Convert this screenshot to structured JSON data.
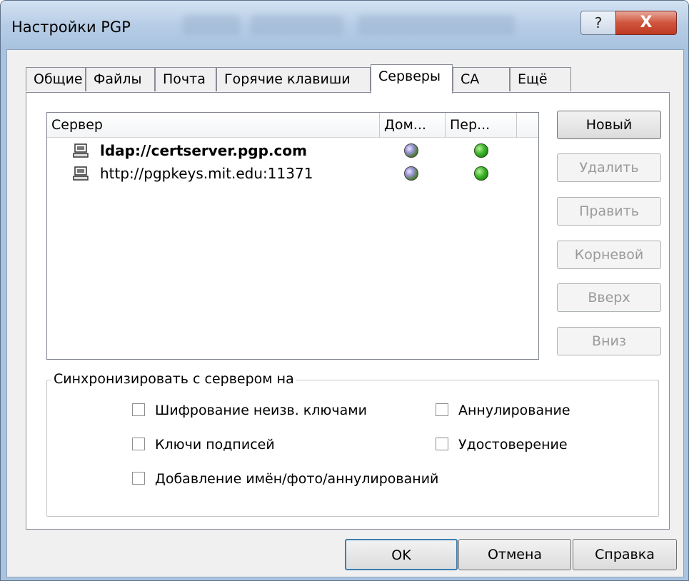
{
  "window": {
    "title": "Настройки PGP",
    "help_label": "?",
    "close_label": "X"
  },
  "tabs": [
    {
      "label": "Общие"
    },
    {
      "label": "Файлы"
    },
    {
      "label": "Почта"
    },
    {
      "label": "Горячие клавиши"
    },
    {
      "label": "Серверы",
      "active": true
    },
    {
      "label": "CA"
    },
    {
      "label": "Ещё"
    }
  ],
  "server_list": {
    "columns": [
      "Сервер",
      "Дом...",
      "Пер..."
    ],
    "rows": [
      {
        "server": "ldap://certserver.pgp.com",
        "bold": true,
        "icon": "computer-icon",
        "domain_status": "globe-icon",
        "root_status": "green-dot-icon"
      },
      {
        "server": "http://pgpkeys.mit.edu:11371",
        "bold": false,
        "icon": "computer-icon",
        "domain_status": "globe-icon",
        "root_status": "green-dot-icon"
      }
    ]
  },
  "side_buttons": [
    {
      "label": "Новый",
      "enabled": true
    },
    {
      "label": "Удалить",
      "enabled": false
    },
    {
      "label": "Править",
      "enabled": false
    },
    {
      "label": "Корневой",
      "enabled": false
    },
    {
      "label": "Вверх",
      "enabled": false
    },
    {
      "label": "Вниз",
      "enabled": false
    }
  ],
  "sync_group": {
    "title": "Синхронизировать с сервером на",
    "options": [
      {
        "label": "Шифрование неизв. ключами",
        "checked": false
      },
      {
        "label": "Аннулирование",
        "checked": false
      },
      {
        "label": "Ключи подписей",
        "checked": false
      },
      {
        "label": "Удостоверение",
        "checked": false
      },
      {
        "label": "Добавление имён/фото/аннулирований",
        "checked": false
      }
    ]
  },
  "footer": {
    "ok_label": "OK",
    "cancel_label": "Отмена",
    "help_label": "Справка"
  },
  "colors": {
    "title_bar": "#b7cde6",
    "close_button": "#c8442c",
    "status_green": "#3bb528"
  }
}
